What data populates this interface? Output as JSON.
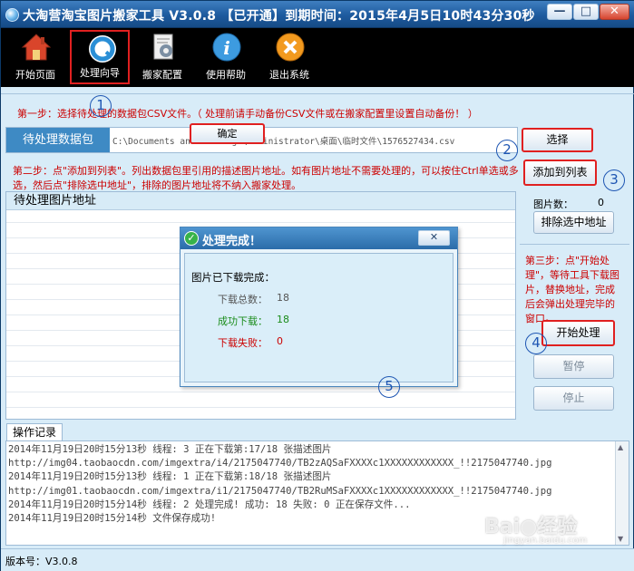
{
  "window": {
    "title": "大淘营淘宝图片搬家工具 V3.0.8 【已开通】到期时间：2015年4月5日10时43分30秒",
    "controls": {
      "minimize": "—",
      "maximize": "□",
      "close": "✕"
    }
  },
  "toolbar": {
    "items": [
      {
        "label": "开始页面",
        "icon": "home-icon"
      },
      {
        "label": "处理向导",
        "icon": "wizard-icon",
        "selected": true
      },
      {
        "label": "搬家配置",
        "icon": "config-icon"
      },
      {
        "label": "使用帮助",
        "icon": "help-icon"
      },
      {
        "label": "退出系统",
        "icon": "exit-icon"
      }
    ]
  },
  "step1": {
    "text": "第一步：选择待处理的数据包CSV文件。（ 处理前请手动备份CSV文件或在搬家配置里设置自动备份！ ）"
  },
  "file": {
    "label": "待处理数据包",
    "path": "C:\\Documents and Settings\\Administrator\\桌面\\临时文件\\1576527434.csv",
    "select_button": "选择"
  },
  "step2": {
    "text": "第二步：点\"添加到列表\"。列出数据包里引用的描述图片地址。如有图片地址不需要处理的，可以按住Ctrl单选或多选，然后点\"排除选中地址\"，排除的图片地址将不纳入搬家处理。",
    "add_button": "添加到列表"
  },
  "list": {
    "header": "待处理图片地址"
  },
  "right_panel": {
    "pic_count_label": "图片数：",
    "pic_count_value": "0",
    "remove_button": "排除选中地址",
    "step3_text": "第三步：点\"开始处理\"，等待工具下载图片，替换地址，完成后会弹出处理完毕的窗口。",
    "start_button": "开始处理",
    "pause_button": "暂停",
    "stop_button": "停止"
  },
  "log": {
    "tab": "操作记录",
    "lines": [
      "2014年11月19日20时15分13秒 线程: 3  正在下载第:17/18 张描述图片",
      "http://img04.taobaocdn.com/imgextra/i4/2175047740/TB2zAQSaFXXXXc1XXXXXXXXXXXX_!!2175047740.jpg",
      "2014年11月19日20时15分13秒 线程: 1  正在下载第:18/18 张描述图片",
      "http://img01.taobaocdn.com/imgextra/i1/2175047740/TB2RuMSaFXXXXc1XXXXXXXXXXXX_!!2175047740.jpg",
      "2014年11月19日20时15分14秒 线程: 2 处理完成! 成功:  18 失败: 0 正在保存文件...",
      "2014年11月19日20时15分14秒 文件保存成功!"
    ]
  },
  "status": {
    "version": "版本号：V3.0.8"
  },
  "dialog": {
    "title": "处理完成！",
    "close": "✕",
    "heading": "图片已下载完成：",
    "total_label": "下载总数：",
    "total_value": "18",
    "ok_label": "成功下载：",
    "ok_value": "18",
    "fail_label": "下载失败：",
    "fail_value": "0",
    "confirm_button": "确定"
  },
  "markers": [
    "1",
    "2",
    "3",
    "4",
    "5"
  ],
  "watermark": {
    "logo": "Bai●经验",
    "url": "jingyan.baidu.com"
  },
  "colors": {
    "titlebar": "#2b6ca9",
    "toolbar_bg": "#000000",
    "instruction_red": "#cc0000",
    "highlight_border": "#e02020",
    "marker_blue": "#1e56b3",
    "success_green": "#1a8c1a"
  }
}
